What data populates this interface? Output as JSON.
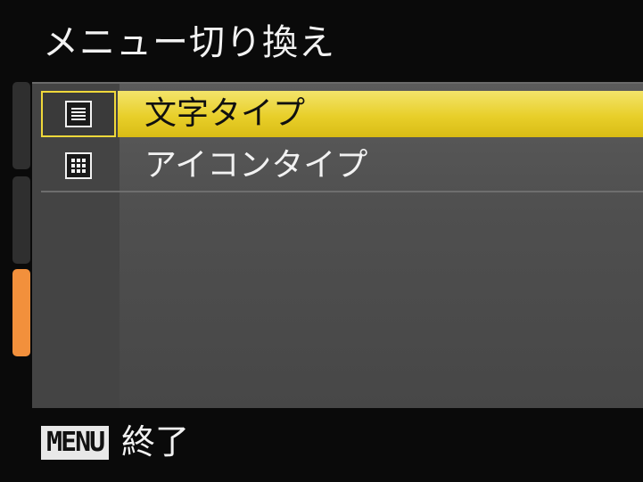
{
  "header": {
    "title": "メニュー切り換え"
  },
  "side_tabs": [
    {
      "name": "tab-1",
      "active": false
    },
    {
      "name": "tab-2",
      "active": false
    },
    {
      "name": "tab-3",
      "active": true,
      "color": "#f2903c"
    }
  ],
  "menu": {
    "items": [
      {
        "label": "文字タイプ",
        "icon": "text-list-icon",
        "selected": true
      },
      {
        "label": "アイコンタイプ",
        "icon": "icon-grid-icon",
        "selected": false
      }
    ]
  },
  "footer": {
    "button_label": "MENU",
    "action_label": "終了"
  },
  "colors": {
    "highlight": "#e8cf2a",
    "accent": "#f2903c",
    "background": "#0a0a0a"
  }
}
